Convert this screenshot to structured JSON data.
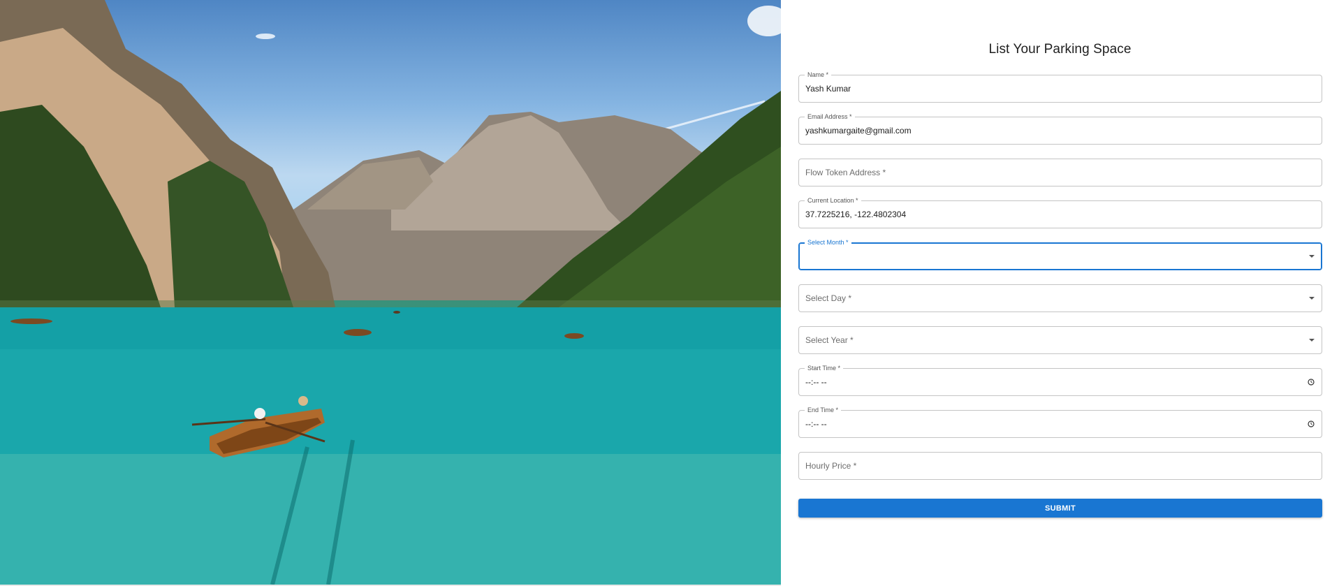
{
  "hero": {
    "image": "lake-boats-mountains-photo"
  },
  "form": {
    "title": "List Your Parking Space",
    "name": {
      "label": "Name *",
      "value": "Yash Kumar"
    },
    "email": {
      "label": "Email Address *",
      "value": "yashkumargaite@gmail.com"
    },
    "flow_token": {
      "placeholder": "Flow Token Address *"
    },
    "location": {
      "label": "Current Location *",
      "value": "37.7225216, -122.4802304"
    },
    "month": {
      "label": "Select Month *",
      "value": ""
    },
    "day": {
      "placeholder": "Select Day *"
    },
    "year": {
      "placeholder": "Select Year *"
    },
    "start_time": {
      "label": "Start Time *",
      "value": "--:-- --"
    },
    "end_time": {
      "label": "End Time *",
      "value": "--:-- --"
    },
    "hourly_price": {
      "placeholder": "Hourly Price *"
    },
    "submit_label": "SUBMIT"
  },
  "colors": {
    "accent": "#1976d2",
    "border": "#c4c4c4"
  }
}
